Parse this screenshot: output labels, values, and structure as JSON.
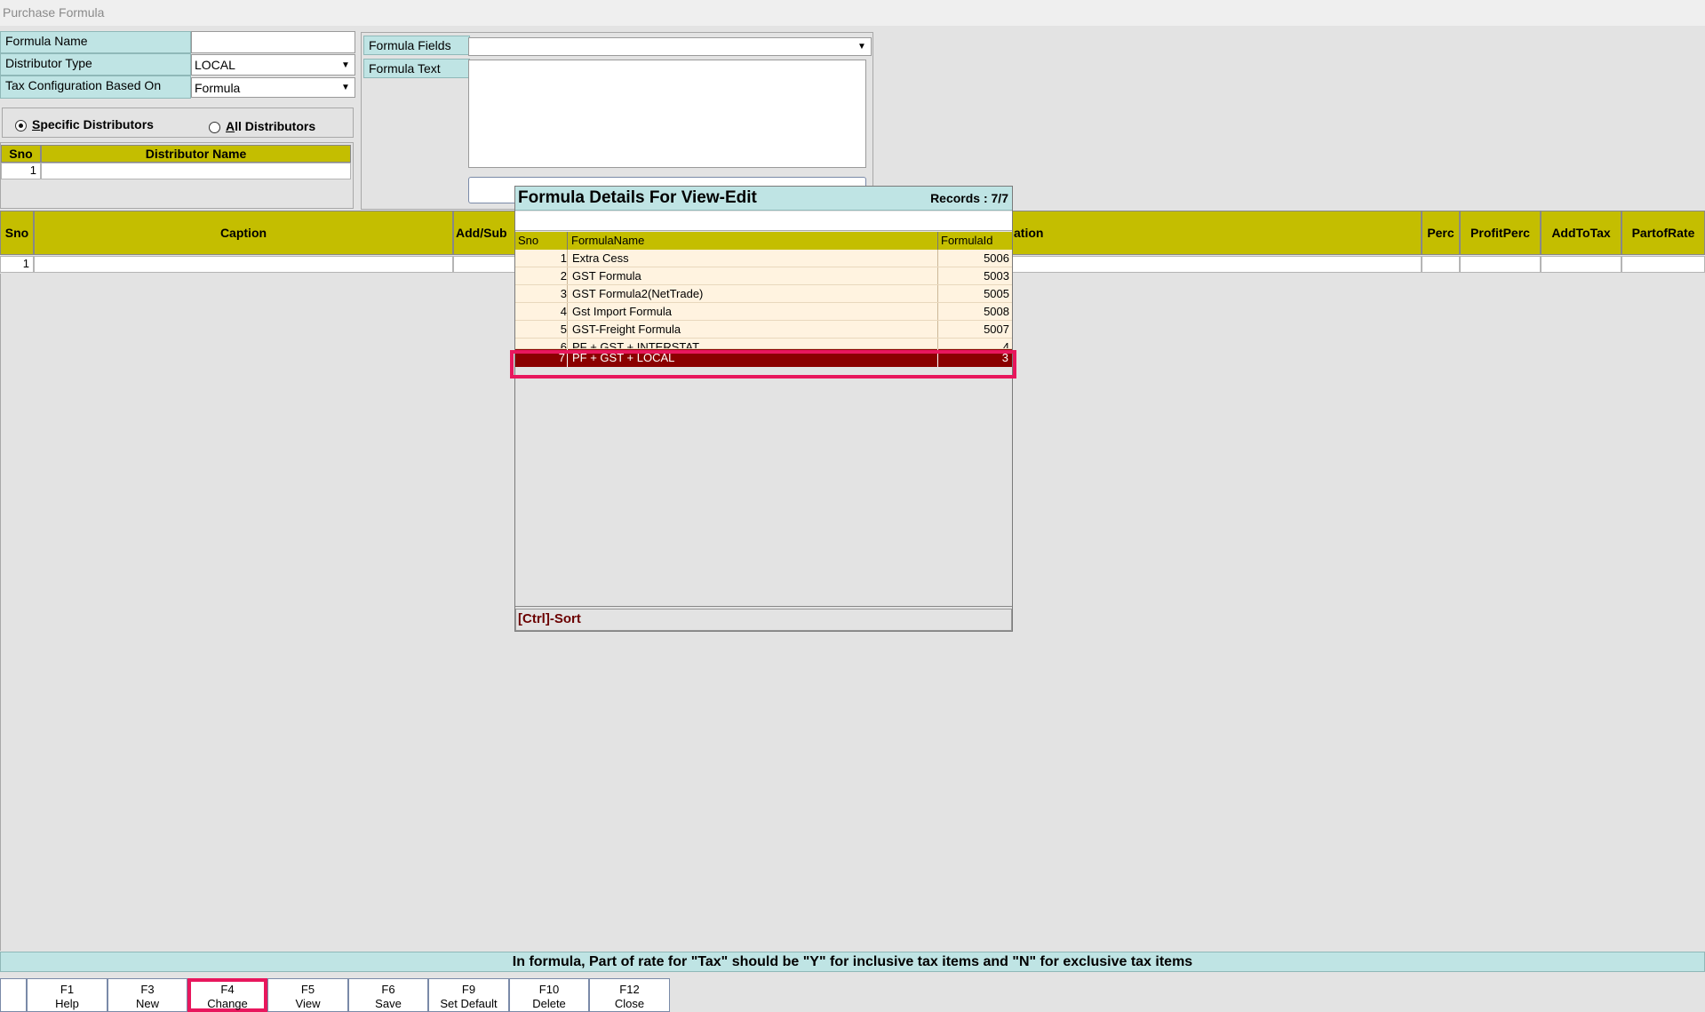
{
  "window": {
    "title": "Purchase Formula"
  },
  "form": {
    "formula_name_label": "Formula Name",
    "formula_name_value": "",
    "distributor_type_label": "Distributor Type",
    "distributor_type_value": "LOCAL",
    "tax_config_label": "Tax Configuration Based On",
    "tax_config_value": "Formula",
    "formula_fields_label": "Formula Fields",
    "formula_fields_value": "",
    "formula_text_label": "Formula Text",
    "formula_text_value": ""
  },
  "radios": {
    "specific_prefix": "S",
    "specific_rest": "pecific Distributors",
    "all_prefix": "A",
    "all_rest": "ll Distributors",
    "selected": "specific"
  },
  "distributor_grid": {
    "col_sno": "Sno",
    "col_name": "Distributor Name",
    "rows": [
      {
        "sno": "1",
        "name": ""
      }
    ]
  },
  "main_grid": {
    "col_sno": "Sno",
    "col_caption": "Caption",
    "col_addsub": "Add/Sub",
    "col_ation": "ation",
    "col_perc": "Perc",
    "col_profitperc": "ProfitPerc",
    "col_addtotax": "AddToTax",
    "col_partofrate": "PartofRate",
    "rows": [
      {
        "sno": "1"
      }
    ]
  },
  "popup": {
    "title": "Formula Details For View-Edit",
    "records": "Records : 7/7",
    "search_value": "",
    "col_sno": "Sno",
    "col_name": "FormulaName",
    "col_id": "FormulaId",
    "rows": [
      {
        "sno": "1",
        "name": "Extra Cess",
        "id": "5006"
      },
      {
        "sno": "2",
        "name": "GST Formula",
        "id": "5003"
      },
      {
        "sno": "3",
        "name": "GST Formula2(NetTrade)",
        "id": "5005"
      },
      {
        "sno": "4",
        "name": "Gst Import Formula",
        "id": "5008"
      },
      {
        "sno": "5",
        "name": "GST-Freight Formula",
        "id": "5007"
      },
      {
        "sno": "6",
        "name": "PF + GST + INTERSTAT",
        "id": "4"
      },
      {
        "sno": "7",
        "name": "PF + GST + LOCAL",
        "id": "3"
      }
    ],
    "footer": "[Ctrl]-Sort"
  },
  "info_bar": "In formula, Part of rate for \"Tax\" should be \"Y\" for inclusive tax items and \"N\" for exclusive tax items",
  "fkeys": [
    {
      "key": "F1",
      "label": "Help"
    },
    {
      "key": "F3",
      "label": "New"
    },
    {
      "key": "F4",
      "label": "Change"
    },
    {
      "key": "F5",
      "label": "View"
    },
    {
      "key": "F6",
      "label": "Save"
    },
    {
      "key": "F9",
      "label": "Set Default"
    },
    {
      "key": "F10",
      "label": "Delete"
    },
    {
      "key": "F12",
      "label": "Close"
    }
  ],
  "colors": {
    "olive_header": "#c4be00",
    "label_bg": "#bfe4e4",
    "selected_row": "#8b0000",
    "highlight_border": "#e8175d"
  }
}
